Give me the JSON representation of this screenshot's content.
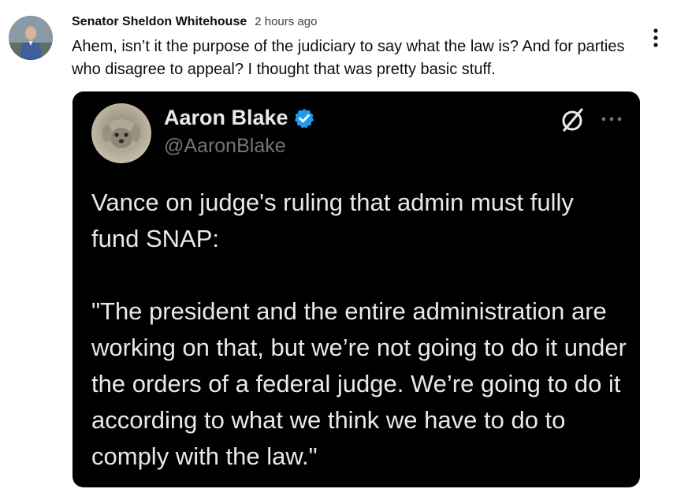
{
  "comment": {
    "author": "Senator Sheldon Whitehouse",
    "timestamp": "2 hours ago",
    "text": "Ahem, isn’t it the purpose of the judiciary to say what the law is? And for parties who disagree to appeal? I thought that was pretty basic stuff.",
    "avatar_icon": "person-photo-icon",
    "menu_icon": "vertical-dots-icon"
  },
  "embedded_post": {
    "display_name": "Aaron Blake",
    "handle": "@AaronBlake",
    "verified_color": "#1d9bf0",
    "paragraphs": [
      "Vance on judge's ruling that admin must fully fund SNAP:",
      "\"The president and the entire administration are working on that, but we’re not going to do it under the orders of a federal judge. We’re going to do it according to what we think we have to do to comply with the law.\""
    ],
    "background_color": "#000000",
    "text_color": "#e7e9ea",
    "muted_color": "#71767b"
  }
}
